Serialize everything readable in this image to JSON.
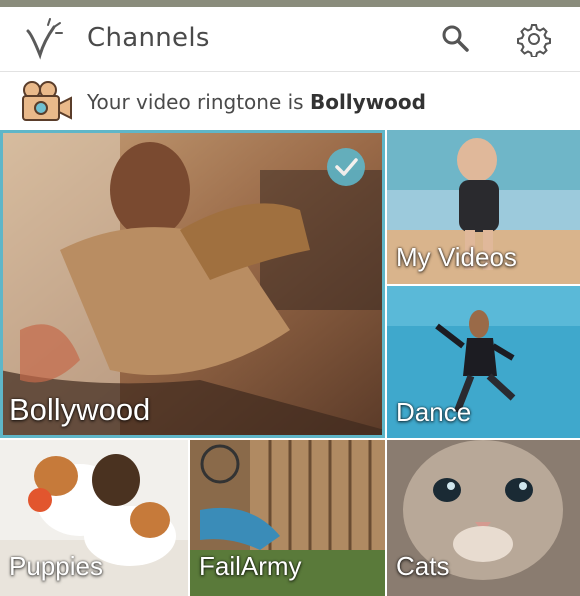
{
  "header": {
    "title": "Channels",
    "logo_icon": "v-logo-icon",
    "search_icon": "search-icon",
    "settings_icon": "gear-icon"
  },
  "ringtone": {
    "prefix": "Your video ringtone is ",
    "channel": "Bollywood",
    "icon": "video-camera-icon"
  },
  "channels": [
    {
      "label": "Bollywood",
      "selected": true
    },
    {
      "label": "My Videos",
      "selected": false
    },
    {
      "label": "Dance",
      "selected": false
    },
    {
      "label": "Puppies",
      "selected": false
    },
    {
      "label": "FailArmy",
      "selected": false
    },
    {
      "label": "Cats",
      "selected": false
    }
  ],
  "colors": {
    "accent": "#5fb6c8",
    "text": "#4a4a4a"
  }
}
